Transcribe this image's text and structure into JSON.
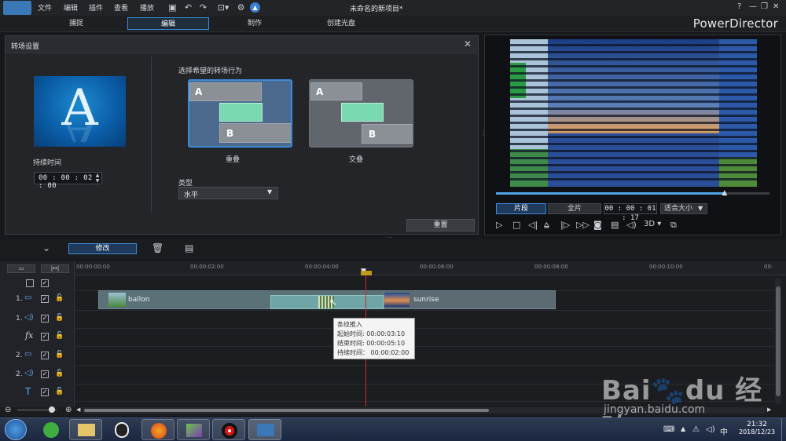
{
  "app": {
    "window_title": "未命名的新项目*",
    "brand": "PowerDirector",
    "menu": [
      "文件",
      "编辑",
      "插件",
      "查看",
      "播放"
    ]
  },
  "modes": [
    "捕捉",
    "编辑",
    "制作",
    "创建光盘"
  ],
  "transition_panel": {
    "title": "转场设置",
    "duration_label": "持续时间",
    "duration_value": "00 : 00 : 02 : 00",
    "thumb_letter": "A",
    "behavior_label": "选择希望的转场行为",
    "options": [
      {
        "label": "重叠",
        "a": "A",
        "b": "B"
      },
      {
        "label": "交叠",
        "a": "A",
        "b": "B"
      }
    ],
    "type_label": "类型",
    "type_value": "水平",
    "reset_label": "重置"
  },
  "preview": {
    "seek_progress": 0.84,
    "clip_tab": "片段",
    "full_tab": "全片",
    "timecode": "00 : 00 : 01 : 17",
    "fit_label": "适合大小",
    "three_d": "3D"
  },
  "toolbar": {
    "modify_label": "修改"
  },
  "ruler_ticks": [
    "00:00:00:00",
    "00:00:02:00",
    "00:00:04:00",
    "00:00:06:00",
    "00:00:08:00",
    "00:00:10:00",
    "00:"
  ],
  "tracks": [
    {
      "num": "1.",
      "kind": "video"
    },
    {
      "num": "1.",
      "kind": "audio"
    },
    {
      "num": "",
      "kind": "fx",
      "symbol": "fx"
    },
    {
      "num": "2.",
      "kind": "video"
    },
    {
      "num": "2.",
      "kind": "audio"
    },
    {
      "num": "",
      "kind": "title",
      "symbol": "T"
    }
  ],
  "clips": [
    {
      "name": "ballon"
    },
    {
      "name": "sunrise"
    }
  ],
  "tooltip": {
    "name": "条纹推入",
    "start": "起始时间: 00:00:03:10",
    "end": "结束时间: 00:00:05:10",
    "duration": "持续时间： 00:00:02:00"
  },
  "taskbar": {
    "time": "21:32",
    "date": "2018/12/23"
  },
  "watermark": {
    "logo": "Bai du 经验",
    "url": "jingyan.baidu.com"
  },
  "colors": {
    "accent": "#3d8ad8",
    "transition_green": "#7ad9b0",
    "playhead": "#dd2222"
  }
}
